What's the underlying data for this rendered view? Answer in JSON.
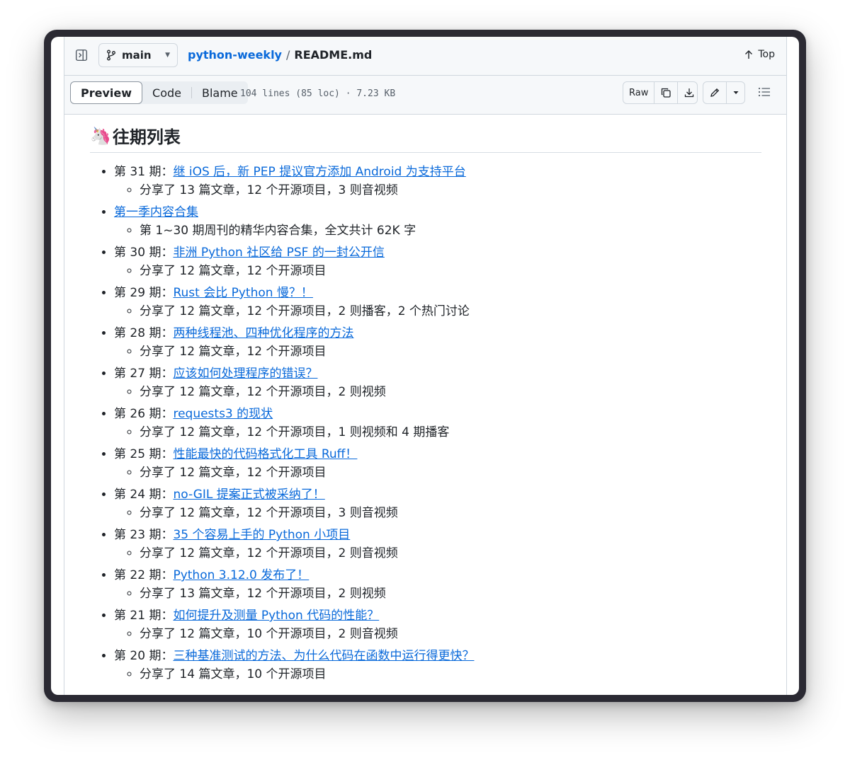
{
  "header": {
    "branch": "main",
    "repo": "python-weekly",
    "separator": "/",
    "file": "README.md",
    "top_label": "Top"
  },
  "toolbar": {
    "tabs": [
      {
        "label": "Preview",
        "active": true
      },
      {
        "label": "Code",
        "active": false
      },
      {
        "label": "Blame",
        "active": false
      }
    ],
    "file_meta": "104 lines (85 loc) · 7.23 KB",
    "raw_label": "Raw",
    "icons": [
      "copy-icon",
      "download-icon",
      "pencil-icon",
      "chevron-down-icon",
      "list-icon"
    ]
  },
  "content": {
    "heading_emoji": "🦄",
    "heading": "往期列表",
    "issues": [
      {
        "prefix": "第 31 期：",
        "title": "继 iOS 后，新 PEP 提议官方添加 Android 为支持平台",
        "summary": "分享了 13 篇文章，12 个开源项目，3 则音视频"
      },
      {
        "prefix": "",
        "title": "第一季内容合集",
        "summary": "第 1~30 期周刊的精华内容合集，全文共计 62K 字"
      },
      {
        "prefix": "第 30 期：",
        "title": "非洲 Python 社区给 PSF 的一封公开信",
        "summary": "分享了 12 篇文章，12 个开源项目"
      },
      {
        "prefix": "第 29 期：",
        "title": "Rust 会比 Python 慢？！",
        "summary": "分享了 12 篇文章，12 个开源项目，2 则播客，2 个热门讨论"
      },
      {
        "prefix": "第 28 期：",
        "title": "两种线程池、四种优化程序的方法",
        "summary": "分享了 12 篇文章，12 个开源项目"
      },
      {
        "prefix": "第 27 期：",
        "title": "应该如何处理程序的错误？",
        "summary": "分享了 12 篇文章，12 个开源项目，2 则视频"
      },
      {
        "prefix": "第 26 期：",
        "title": "requests3 的现状",
        "summary": "分享了 12 篇文章，12 个开源项目，1 则视频和 4 期播客"
      },
      {
        "prefix": "第 25 期：",
        "title": "性能最快的代码格式化工具 Ruff！",
        "summary": "分享了 12 篇文章，12 个开源项目"
      },
      {
        "prefix": "第 24 期：",
        "title": "no-GIL 提案正式被采纳了！",
        "summary": "分享了 12 篇文章，12 个开源项目，3 则音视频"
      },
      {
        "prefix": "第 23 期：",
        "title": "35 个容易上手的 Python 小项目",
        "summary": "分享了 12 篇文章，12 个开源项目，2 则音视频"
      },
      {
        "prefix": "第 22 期：",
        "title": "Python 3.12.0 发布了！",
        "summary": "分享了 13 篇文章，12 个开源项目，2 则视频"
      },
      {
        "prefix": "第 21 期：",
        "title": "如何提升及测量 Python 代码的性能？",
        "summary": "分享了 12 篇文章，10 个开源项目，2 则音视频"
      },
      {
        "prefix": "第 20 期：",
        "title": "三种基准测试的方法、为什么代码在函数中运行得更快？",
        "summary": "分享了 14 篇文章，10 个开源项目"
      }
    ]
  },
  "colors": {
    "link": "#0969da",
    "frame": "#2b2a33",
    "header_bg": "#f6f8fa",
    "border": "#d0d7de"
  }
}
